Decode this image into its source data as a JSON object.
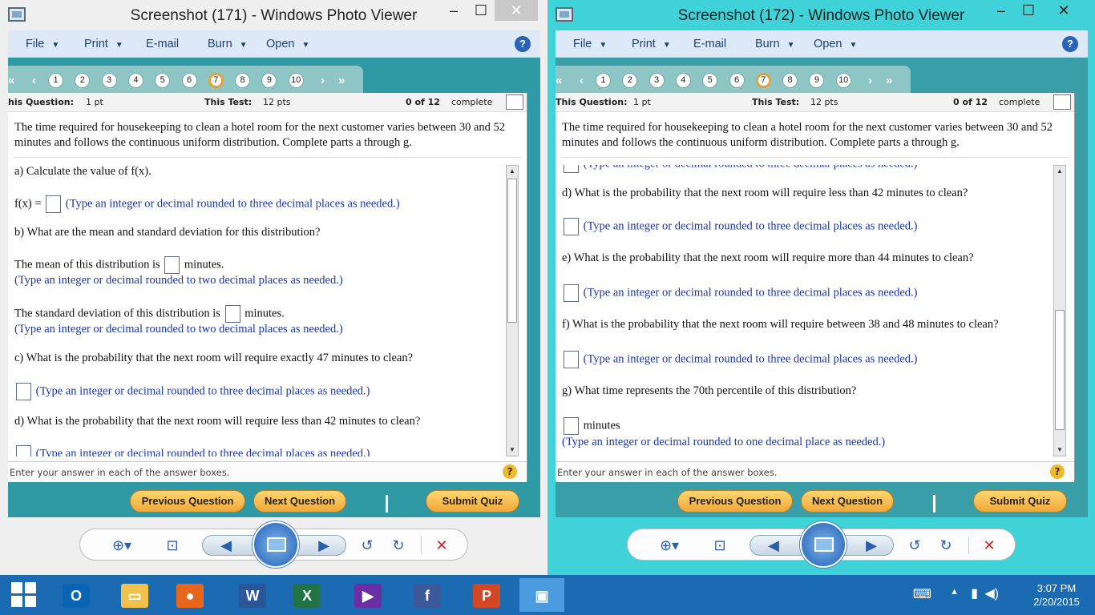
{
  "left": {
    "title": "Screenshot (171) - Windows Photo Viewer",
    "menu": [
      "File",
      "Print",
      "E-mail",
      "Burn",
      "Open"
    ],
    "help": "?",
    "controls": {
      "min": "–",
      "max": "☐",
      "close": "✕"
    },
    "qnums": [
      "1",
      "2",
      "3",
      "4",
      "5",
      "6",
      "7",
      "8",
      "9",
      "10"
    ],
    "info": {
      "q_label": "his Question:",
      "q_val": "1 pt",
      "t_label": "This Test:",
      "t_val": "12 pts",
      "progress": "0 of 12",
      "complete": "complete"
    },
    "intro": "The time required for housekeeping to clean a hotel room for the next customer varies between 30 and 52 minutes and follows the continuous uniform distribution. Complete parts a through g.",
    "lines": [
      {
        "text": "a) Calculate the value of f(x).",
        "box": false,
        "pre": "",
        "post": "",
        "blue": ""
      },
      {
        "text": "",
        "pre": "f(x) =",
        "box": true,
        "post": "",
        "blue": "(Type an integer or decimal rounded to three decimal places as needed.)"
      },
      {
        "text": "b) What are the mean and standard deviation for this distribution?",
        "box": false,
        "pre": "",
        "post": "",
        "blue": ""
      },
      {
        "text": "",
        "pre": "The mean of this distribution is",
        "box": true,
        "post": "minutes.",
        "blue": ""
      },
      {
        "text": "",
        "pre": "",
        "box": false,
        "post": "",
        "blue": "(Type an integer or decimal rounded to two decimal places as needed.)"
      },
      {
        "text": "",
        "pre": "The standard deviation of this distribution is",
        "box": true,
        "post": "minutes.",
        "blue": ""
      },
      {
        "text": "",
        "pre": "",
        "box": false,
        "post": "",
        "blue": "(Type an integer or decimal rounded to two decimal places as needed.)"
      },
      {
        "text": "c) What is the probability that the next room will require exactly 47 minutes to clean?",
        "box": false,
        "pre": "",
        "post": "",
        "blue": ""
      },
      {
        "text": "",
        "pre": "",
        "box": true,
        "post": "",
        "blue": "(Type an integer or decimal rounded to three decimal places as needed.)"
      },
      {
        "text": "d) What is the probability that the next room will require less than 42 minutes to clean?",
        "box": false,
        "pre": "",
        "post": "",
        "blue": ""
      },
      {
        "text": "",
        "pre": "",
        "box": true,
        "post": "",
        "blue": "(Type an integer or decimal rounded to three decimal places as needed.)"
      }
    ],
    "footer": "Enter your answer in each of the answer boxes.",
    "buttons": {
      "prev": "Previous Question",
      "next": "Next Question",
      "submit": "Submit Quiz"
    }
  },
  "right": {
    "title": "Screenshot (172) - Windows Photo Viewer",
    "menu": [
      "File",
      "Print",
      "E-mail",
      "Burn",
      "Open"
    ],
    "help": "?",
    "controls": {
      "min": "–",
      "max": "☐",
      "close": "✕"
    },
    "qnums": [
      "1",
      "2",
      "3",
      "4",
      "5",
      "6",
      "7",
      "8",
      "9",
      "10"
    ],
    "info": {
      "q_label": "This Question:",
      "q_val": "1 pt",
      "t_label": "This Test:",
      "t_val": "12 pts",
      "progress": "0 of 12",
      "complete": "complete"
    },
    "intro": "The time required for housekeeping to clean a hotel room for the next customer varies between 30 and 52 minutes and follows the continuous uniform distribution. Complete parts a through g.",
    "lines": [
      {
        "text": "",
        "pre": "",
        "box": true,
        "post": "",
        "blue": "(Type an integer or decimal rounded to three decimal places as needed.)"
      },
      {
        "text": "d) What is the probability that the next room will require less than 42 minutes to clean?",
        "box": false,
        "pre": "",
        "post": "",
        "blue": ""
      },
      {
        "text": "",
        "pre": "",
        "box": true,
        "post": "",
        "blue": "(Type an integer or decimal rounded to three decimal places as needed.)"
      },
      {
        "text": "e) What is the probability that the next room will require more than 44 minutes to clean?",
        "box": false,
        "pre": "",
        "post": "",
        "blue": ""
      },
      {
        "text": "",
        "pre": "",
        "box": true,
        "post": "",
        "blue": "(Type an integer or decimal rounded to three decimal places as needed.)"
      },
      {
        "text": "f) What is the probability that the next room will require between 38 and 48 minutes to clean?",
        "box": false,
        "pre": "",
        "post": "",
        "blue": ""
      },
      {
        "text": "",
        "pre": "",
        "box": true,
        "post": "",
        "blue": "(Type an integer or decimal rounded to three decimal places as needed.)"
      },
      {
        "text": "g) What time represents the 70th percentile of this distribution?",
        "box": false,
        "pre": "",
        "post": "",
        "blue": ""
      },
      {
        "text": "",
        "pre": "",
        "box": true,
        "post": "minutes",
        "blue": ""
      },
      {
        "text": "",
        "pre": "",
        "box": false,
        "post": "",
        "blue": "(Type an integer or decimal rounded to one decimal place as needed.)"
      }
    ],
    "footer": "Enter your answer in each of the answer boxes.",
    "buttons": {
      "prev": "Previous Question",
      "next": "Next Question",
      "submit": "Submit Quiz"
    }
  },
  "taskbar": {
    "apps": [
      "outlook-icon",
      "file-explorer-icon",
      "firefox-icon",
      "word-icon",
      "excel-icon",
      "video-icon",
      "facebook-icon",
      "powerpoint-icon",
      "photo-viewer-icon"
    ],
    "app_glyphs": [
      "O",
      "▭",
      "●",
      "W",
      "X",
      "▶",
      "f",
      "P",
      "▣"
    ],
    "app_colors": [
      "#0a64b4",
      "#f2c14b",
      "#e8661c",
      "#2b579a",
      "#217346",
      "#6b2fa3",
      "#3b5998",
      "#d24726",
      "#4a9be0"
    ],
    "time": "3:07 PM",
    "date": "2/20/2015"
  }
}
